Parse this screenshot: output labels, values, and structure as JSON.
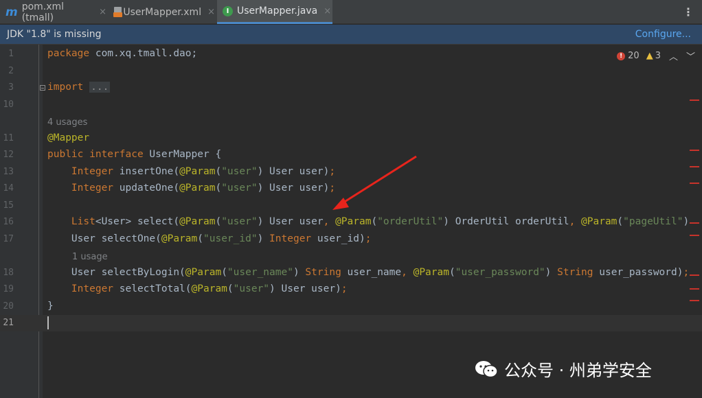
{
  "tabs": [
    {
      "label": "pom.xml (tmall)",
      "icon": "maven-m-icon",
      "active": false
    },
    {
      "label": "UserMapper.xml",
      "icon": "xml-file-icon",
      "active": false
    },
    {
      "label": "UserMapper.java",
      "icon": "interface-i-icon",
      "active": true
    }
  ],
  "tab_close_glyph": "×",
  "notice": {
    "message": "JDK \"1.8\" is missing",
    "action": "Configure..."
  },
  "inspection": {
    "errors": "20",
    "warnings": "3"
  },
  "lines": [
    {
      "n": "1",
      "text": "package com.xq.tmall.dao;"
    },
    {
      "n": "2",
      "text": ""
    },
    {
      "n": "3",
      "text": "import ..."
    },
    {
      "n": "10",
      "text": ""
    },
    {
      "n": "11",
      "text": "@Mapper"
    },
    {
      "n": "12",
      "text": "public interface UserMapper {"
    },
    {
      "n": "13",
      "text": "    Integer insertOne(@Param(\"user\") User user);"
    },
    {
      "n": "14",
      "text": "    Integer updateOne(@Param(\"user\") User user);"
    },
    {
      "n": "15",
      "text": ""
    },
    {
      "n": "16",
      "text": "    List<User> select(@Param(\"user\") User user, @Param(\"orderUtil\") OrderUtil orderUtil, @Param(\"pageUtil\")"
    },
    {
      "n": "17",
      "text": "    User selectOne(@Param(\"user_id\") Integer user_id);"
    },
    {
      "n": "18",
      "text": "    User selectByLogin(@Param(\"user_name\") String user_name, @Param(\"user_password\") String user_password);"
    },
    {
      "n": "19",
      "text": "    Integer selectTotal(@Param(\"user\") User user);"
    },
    {
      "n": "20",
      "text": "}"
    },
    {
      "n": "21",
      "text": ""
    }
  ],
  "usage_hints": {
    "interface": "4 usages",
    "selectByLogin": "1 usage"
  },
  "watermark": "公众号 · 州弟学安全",
  "colors": {
    "keyword": "#cc7832",
    "annotation": "#bbb529",
    "string": "#6a8759",
    "text": "#a9b7c6",
    "error_marker": "#c7332b",
    "arrow": "#e8241c",
    "active_tab_underline": "#4a88c7"
  }
}
